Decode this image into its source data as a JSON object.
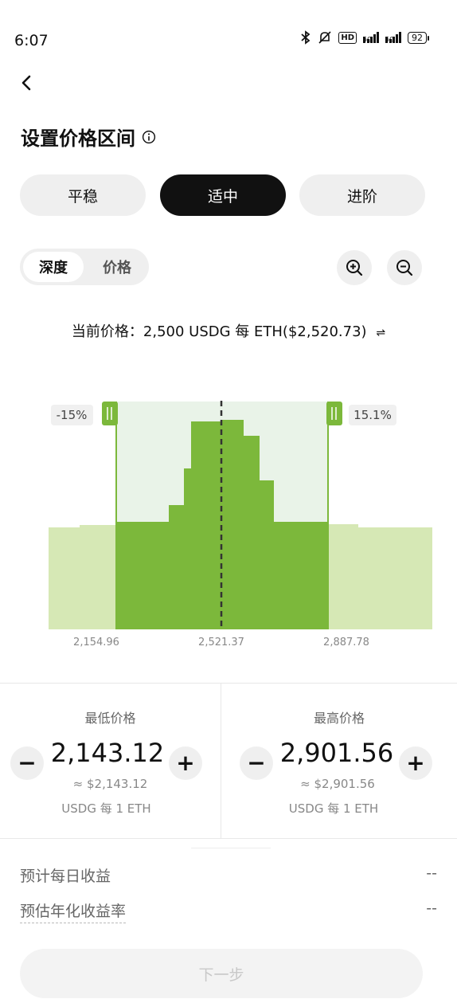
{
  "status": {
    "time": "6:07",
    "hd": "HD",
    "net1": "5G",
    "net2": "5G",
    "battery": "92"
  },
  "page": {
    "title": "设置价格区间"
  },
  "strategy_tabs": [
    {
      "label": "平稳",
      "active": false
    },
    {
      "label": "适中",
      "active": true
    },
    {
      "label": "进阶",
      "active": false
    }
  ],
  "view_toggle": {
    "depth": "深度",
    "price": "价格",
    "selected": "深度"
  },
  "current_price": "当前价格：2,500 USDG 每 ETH($2,520.73)",
  "chart": {
    "low_pct": "-15%",
    "high_pct": "15.1%",
    "ticks": [
      "2,154.96",
      "2,521.37",
      "2,887.78"
    ],
    "colors": {
      "inside": "#7cb83b",
      "outside": "#d6e8b5",
      "band": "#e9f3e8"
    }
  },
  "min_price": {
    "label": "最低价格",
    "value": "2,143.12",
    "usd": "≈ $2,143.12",
    "unit": "USDG 每 1 ETH",
    "minus": "−",
    "plus": "+"
  },
  "max_price": {
    "label": "最高价格",
    "value": "2,901.56",
    "usd": "≈ $2,901.56",
    "unit": "USDG 每 1 ETH",
    "minus": "−",
    "plus": "+"
  },
  "estimates": {
    "daily_label": "预计每日收益",
    "daily_value": "--",
    "apr_label": "预估年化收益率",
    "apr_value": "--"
  },
  "next_button": "下一步"
}
